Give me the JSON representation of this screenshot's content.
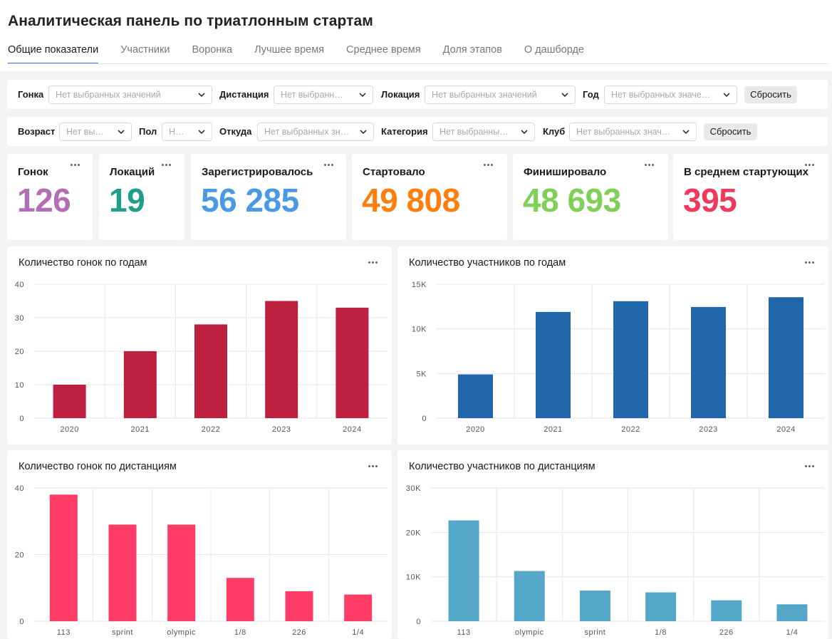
{
  "header": {
    "title": "Аналитическая панель по триатлонным стартам",
    "tabs": [
      {
        "label": "Общие показатели",
        "active": true
      },
      {
        "label": "Участники"
      },
      {
        "label": "Воронка"
      },
      {
        "label": "Лучшее время"
      },
      {
        "label": "Среднее время"
      },
      {
        "label": "Доля этапов"
      },
      {
        "label": "О дашборде"
      }
    ]
  },
  "filters_row1": {
    "race": {
      "label": "Гонка",
      "placeholder": "Нет выбранных значений"
    },
    "distance": {
      "label": "Дистанция",
      "placeholder": "Нет выбранных значений"
    },
    "location": {
      "label": "Локация",
      "placeholder": "Нет выбранных значений"
    },
    "year": {
      "label": "Год",
      "placeholder": "Нет выбранных значений"
    },
    "reset_label": "Сбросить"
  },
  "filters_row2": {
    "age": {
      "label": "Возраст",
      "placeholder": "Нет выбранных значений"
    },
    "sex": {
      "label": "Пол",
      "placeholder": "Нет выбранных значений"
    },
    "from": {
      "label": "Откуда",
      "placeholder": "Нет выбранных значений"
    },
    "category": {
      "label": "Категория",
      "placeholder": "Нет выбранных значений"
    },
    "club": {
      "label": "Клуб",
      "placeholder": "Нет выбранных значений"
    },
    "reset_label": "Сбросить"
  },
  "kpis": [
    {
      "label": "Гонок",
      "value": "126",
      "color": "#b36fb5"
    },
    {
      "label": "Локаций",
      "value": "19",
      "color": "#1f9e88"
    },
    {
      "label": "Зарегистрировалось",
      "value": "56 285",
      "color": "#4a9ae3"
    },
    {
      "label": "Стартовало",
      "value": "49 808",
      "color": "#ff7f0e"
    },
    {
      "label": "Финишировало",
      "value": "48 693",
      "color": "#80cf56"
    },
    {
      "label": "В среднем стартующих",
      "value": "395",
      "color": "#ef3a5d"
    }
  ],
  "icons": {
    "menu": "more-dots-icon",
    "dropdown": "chevron-down-icon"
  },
  "chart_data": [
    {
      "id": "races-by-year",
      "type": "bar",
      "title": "Количество гонок по годам",
      "categories": [
        "2020",
        "2021",
        "2022",
        "2023",
        "2024"
      ],
      "values": [
        10,
        20,
        28,
        35,
        33
      ],
      "ylim": [
        0,
        40
      ],
      "yticks": [
        0,
        10,
        20,
        30,
        40
      ],
      "ytick_labels": [
        "0",
        "10",
        "20",
        "30",
        "40"
      ],
      "color": "#be2140",
      "grid": true
    },
    {
      "id": "participants-by-year",
      "type": "bar",
      "title": "Количество участников по годам",
      "categories": [
        "2020",
        "2021",
        "2022",
        "2023",
        "2024"
      ],
      "values": [
        4900,
        11900,
        13100,
        12450,
        13550
      ],
      "ylim": [
        0,
        15000
      ],
      "yticks": [
        0,
        5000,
        10000,
        15000
      ],
      "ytick_labels": [
        "0",
        "5K",
        "10K",
        "15K"
      ],
      "color": "#1f67aa",
      "grid": true
    },
    {
      "id": "races-by-distance",
      "type": "bar",
      "title": "Количество гонок по дистанциям",
      "categories": [
        "113",
        "sprint",
        "olympic",
        "1/8",
        "226",
        "1/4"
      ],
      "values": [
        38,
        29,
        29,
        13,
        9,
        8
      ],
      "ylim": [
        0,
        40
      ],
      "yticks": [
        0,
        20,
        40
      ],
      "ytick_labels": [
        "0",
        "20",
        "40"
      ],
      "color": "#ff3c65",
      "grid": true
    },
    {
      "id": "participants-by-distance",
      "type": "bar",
      "title": "Количество участников по дистанциям",
      "categories": [
        "113",
        "olympic",
        "sprint",
        "1/8",
        "226",
        "1/4"
      ],
      "values": [
        22700,
        11300,
        6900,
        6500,
        4700,
        3800
      ],
      "ylim": [
        0,
        30000
      ],
      "yticks": [
        0,
        10000,
        20000,
        30000
      ],
      "ytick_labels": [
        "0",
        "10K",
        "20K",
        "30K"
      ],
      "color": "#54a7c8",
      "grid": true
    }
  ]
}
